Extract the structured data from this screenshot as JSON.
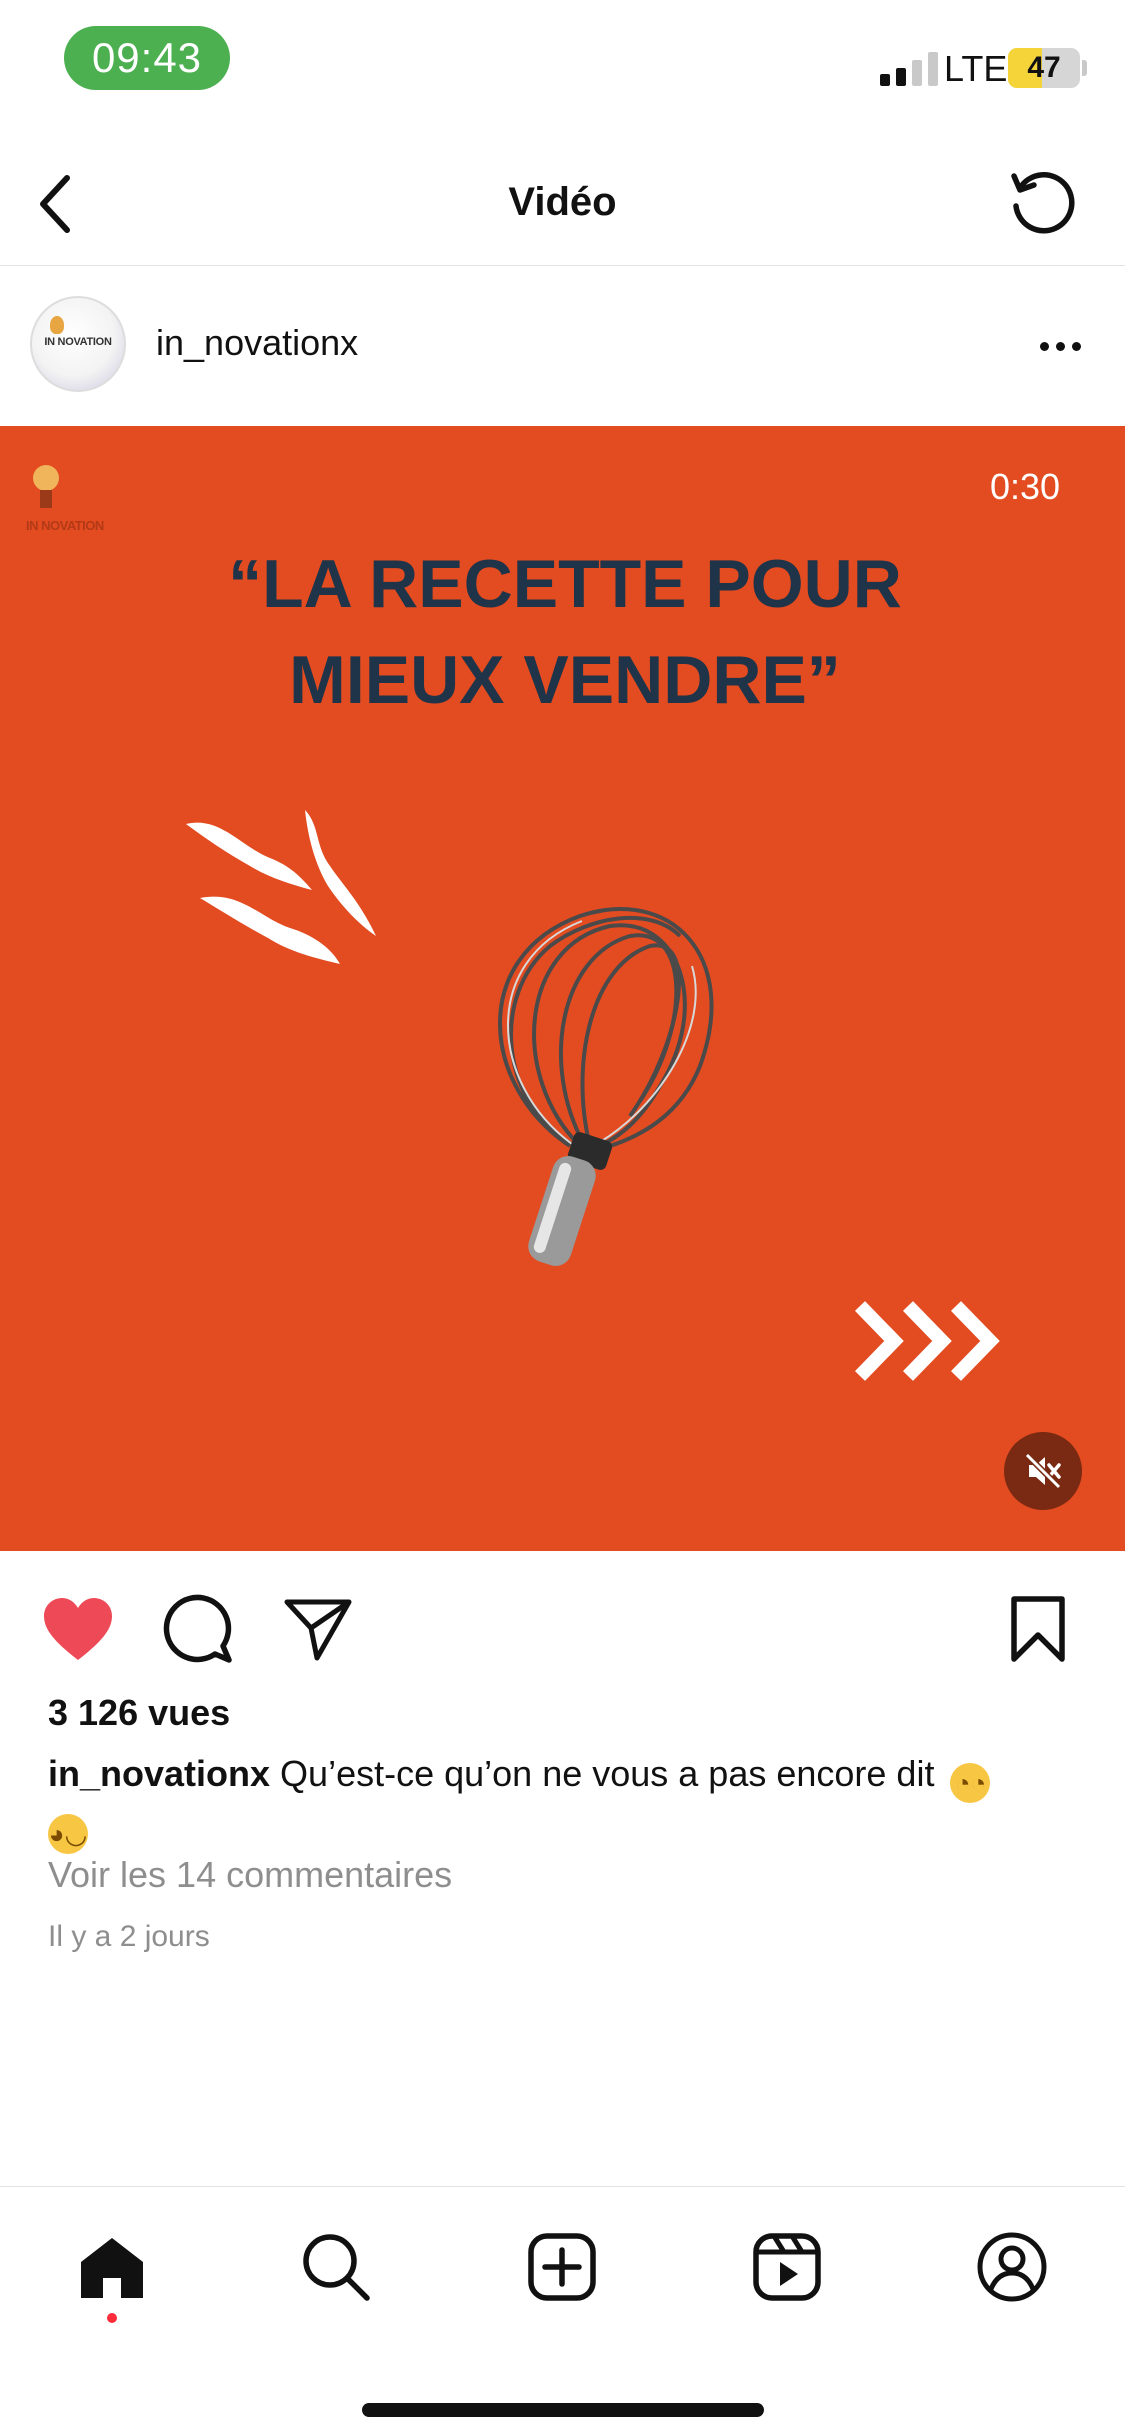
{
  "status_bar": {
    "time": "09:43",
    "network": "LTE",
    "battery_level": "47",
    "battery_fraction": 0.47,
    "battery_color": "#f5d43a",
    "signal_bars_active": 2,
    "signal_bars_total": 4
  },
  "nav": {
    "title": "Vidéo",
    "back_icon": "chevron-left-icon",
    "refresh_icon": "refresh-icon"
  },
  "post": {
    "username": "in_novationx",
    "avatar_text": "IN NOVATION",
    "more_icon": "more-horizontal-icon"
  },
  "video": {
    "duration": "0:30",
    "headline_line1": "“LA RECETTE POUR",
    "headline_line2": "MIEUX VENDRE”",
    "logo_text": "IN NOVATION",
    "background_color": "#e34b21",
    "headline_color": "#1f3448",
    "mute_icon": "speaker-muted-icon"
  },
  "actions": {
    "like_icon": "heart-filled-icon",
    "comment_icon": "comment-icon",
    "share_icon": "send-icon",
    "save_icon": "bookmark-icon",
    "like_color": "#ed4956"
  },
  "stats": {
    "views": "3 126 vues"
  },
  "caption": {
    "username": "in_novationx",
    "text": "Qu’est-ce qu’on ne vous a pas encore dit"
  },
  "comments_link": "Voir les 14 commentaires",
  "timestamp": "Il y a 2 jours",
  "tab_bar": {
    "items": [
      "home-icon",
      "search-icon",
      "create-icon",
      "reels-icon",
      "profile-icon"
    ],
    "active": "home-icon"
  }
}
